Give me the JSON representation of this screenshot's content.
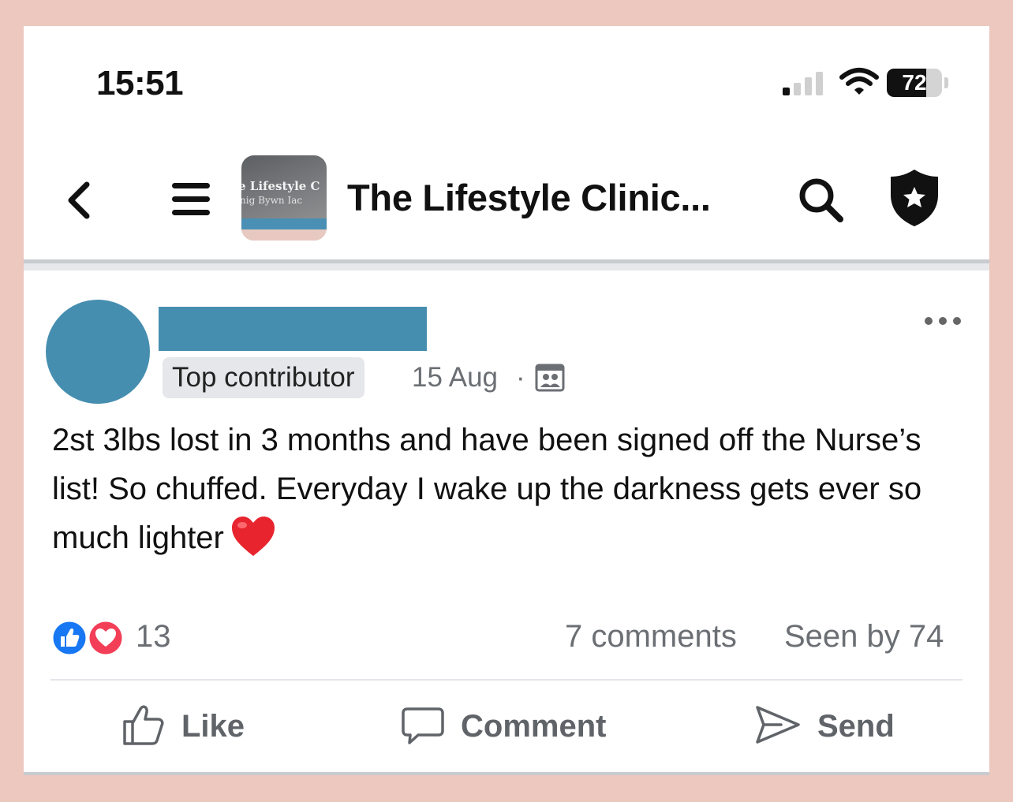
{
  "status_bar": {
    "time": "15:51",
    "battery_percent": "72",
    "battery_level": 0.72
  },
  "header": {
    "group_name": "The Lifestyle Clinic...",
    "group_thumbnail": {
      "line1": "e Lifestyle C",
      "line2": "nig Bywn Iac"
    },
    "icons": [
      "back-chevron-icon",
      "menu-icon",
      "search-icon",
      "shield-star-icon"
    ]
  },
  "post": {
    "badge": "Top contributor",
    "date": "15 Aug",
    "separator": "·",
    "text": "2st 3lbs lost in 3 months and have been signed off the Nurse’s list! So chuffed. Everyday I wake up the darkness gets ever so much lighter",
    "emoji": "red-heart",
    "reactions": {
      "types": [
        "like",
        "love"
      ],
      "count": "13"
    },
    "comments": "7 comments",
    "seen_by": "Seen by 74"
  },
  "actions": {
    "like": "Like",
    "comment": "Comment",
    "send": "Send"
  },
  "colors": {
    "background": "#ecc8bf",
    "redaction": "#468eb0",
    "facebook_blue": "#1877f2",
    "love_red": "#f33e58",
    "muted_text": "#6b6f74"
  }
}
